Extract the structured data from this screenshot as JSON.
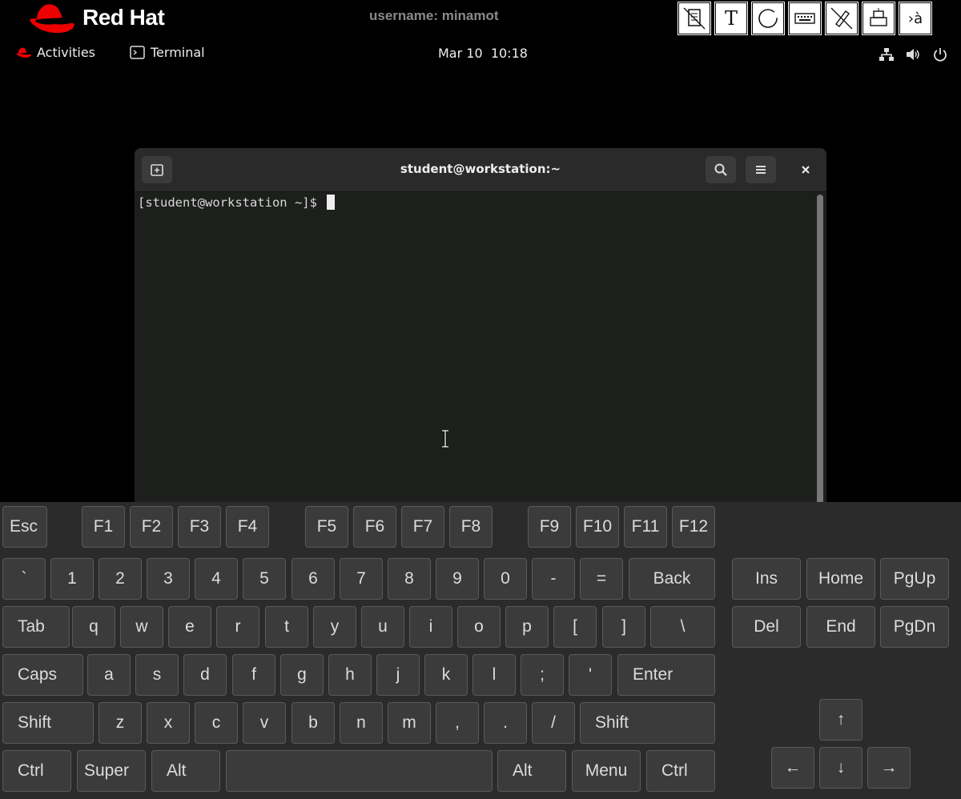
{
  "header": {
    "brand": "Red Hat",
    "username_label": "username: minamot"
  },
  "accessibility_toolbar": [
    {
      "name": "document-disabled-icon"
    },
    {
      "name": "text-icon",
      "glyph": "T"
    },
    {
      "name": "circle-icon"
    },
    {
      "name": "keyboard-icon"
    },
    {
      "name": "pen-disabled-icon"
    },
    {
      "name": "print-icon"
    },
    {
      "name": "input-method-icon",
      "glyph": "›à"
    }
  ],
  "topbar": {
    "activities": "Activities",
    "app_name": "Terminal",
    "date": "Mar 10",
    "time": "10:18"
  },
  "terminal": {
    "title": "student@workstation:~",
    "prompt": "[student@workstation ~]$"
  },
  "keyboard": {
    "rows": [
      [
        "Esc",
        "F1",
        "F2",
        "F3",
        "F4",
        "F5",
        "F6",
        "F7",
        "F8",
        "F9",
        "F10",
        "F11",
        "F12"
      ],
      [
        "`",
        "1",
        "2",
        "3",
        "4",
        "5",
        "6",
        "7",
        "8",
        "9",
        "0",
        "-",
        "=",
        "Back",
        "Ins",
        "Home",
        "PgUp"
      ],
      [
        "Tab",
        "q",
        "w",
        "e",
        "r",
        "t",
        "y",
        "u",
        "i",
        "o",
        "p",
        "[",
        "]",
        "\\",
        "Del",
        "End",
        "PgDn"
      ],
      [
        "Caps",
        "a",
        "s",
        "d",
        "f",
        "g",
        "h",
        "j",
        "k",
        "l",
        ";",
        "'",
        "Enter"
      ],
      [
        "Shift",
        "z",
        "x",
        "c",
        "v",
        "b",
        "n",
        "m",
        ",",
        ".",
        "/",
        "Shift",
        "↑"
      ],
      [
        "Ctrl",
        "Super",
        "Alt",
        "",
        "Alt",
        "Menu",
        "Ctrl",
        "←",
        "↓",
        "→"
      ]
    ]
  }
}
